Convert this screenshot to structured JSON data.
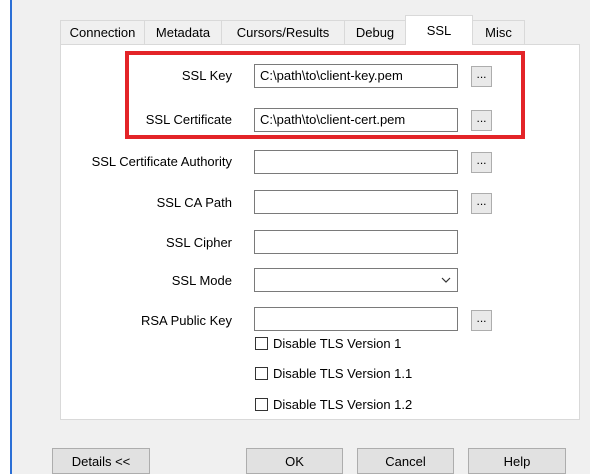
{
  "tabs": [
    {
      "label": "Connection",
      "active": false
    },
    {
      "label": "Metadata",
      "active": false
    },
    {
      "label": "Cursors/Results",
      "active": false
    },
    {
      "label": "Debug",
      "active": false
    },
    {
      "label": "SSL",
      "active": true
    },
    {
      "label": "Misc",
      "active": false
    }
  ],
  "fields": {
    "ssl_key": {
      "label": "SSL Key",
      "value": "C:\\path\\to\\client-key.pem",
      "browse": "..."
    },
    "ssl_certificate": {
      "label": "SSL Certificate",
      "value": "C:\\path\\to\\client-cert.pem",
      "browse": "..."
    },
    "ssl_ca": {
      "label": "SSL Certificate Authority",
      "value": "",
      "browse": "..."
    },
    "ssl_ca_path": {
      "label": "SSL CA Path",
      "value": "",
      "browse": "..."
    },
    "ssl_cipher": {
      "label": "SSL Cipher",
      "value": ""
    },
    "ssl_mode": {
      "label": "SSL Mode",
      "value": ""
    },
    "rsa_public_key": {
      "label": "RSA Public Key",
      "value": "",
      "browse": "..."
    }
  },
  "checkboxes": [
    {
      "label": "Disable TLS Version 1",
      "checked": false
    },
    {
      "label": "Disable TLS Version 1.1",
      "checked": false
    },
    {
      "label": "Disable TLS Version 1.2",
      "checked": false
    }
  ],
  "buttons": {
    "details": "Details <<",
    "ok": "OK",
    "cancel": "Cancel",
    "help": "Help"
  },
  "colors": {
    "highlight": "#e32428",
    "accent_line": "#2b6fd6"
  },
  "icons": {
    "select_arrow": "chevron-down-icon"
  }
}
